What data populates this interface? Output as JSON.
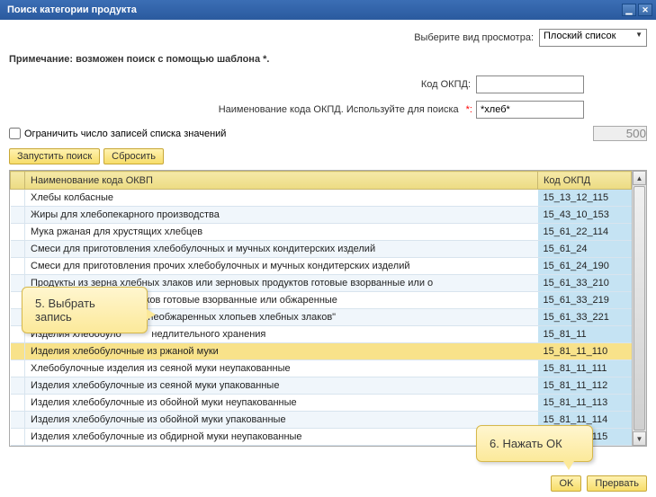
{
  "title": "Поиск категории продукта",
  "view": {
    "label": "Выберите вид просмотра:",
    "value": "Плоский список"
  },
  "note": "Примечание: возможен поиск с помощью шаблона *.",
  "code": {
    "label": "Код ОКПД:",
    "value": ""
  },
  "name_search": {
    "label": "Наименование кода ОКПД. Используйте для поиска",
    "req": "*:",
    "value": "*хлеб*"
  },
  "limit": {
    "label": "Ограничить число записей списка значений",
    "value": "500"
  },
  "buttons": {
    "search": "Запустить поиск",
    "reset": "Сбросить",
    "ok": "OK",
    "cancel": "Прервать"
  },
  "columns": {
    "name": "Наименование кода ОКВП",
    "code": "Код ОКПД"
  },
  "rows": [
    {
      "name": "Хлебы колбасные",
      "code": "15_13_12_115"
    },
    {
      "name": "Жиры для хлебопекарного производства",
      "code": "15_43_10_153"
    },
    {
      "name": "Мука ржаная для хрустящих хлебцев",
      "code": "15_61_22_114"
    },
    {
      "name": "Смеси для приготовления хлебобулочных и мучных кондитерских изделий",
      "code": "15_61_24"
    },
    {
      "name": "Смеси для приготовления прочих хлебобулочных и мучных кондитерских изделий",
      "code": "15_61_24_190"
    },
    {
      "name": "Продукты из зерна хлебных злаков или зерновых продуктов готовые взорванные или о",
      "code": "15_61_33_210"
    },
    {
      "name": "                                    злаков готовые взорванные или обжаренные",
      "code": "15_61_33_219"
    },
    {
      "name": "                              основе необжаренных хлопьев хлебных злаков\"",
      "code": "15_61_33_221"
    },
    {
      "name": "Изделия хлебобуло           недлительного хранения",
      "code": "15_81_11"
    },
    {
      "name": "Изделия хлебобулочные из ржаной муки",
      "code": "15_81_11_110",
      "selected": true
    },
    {
      "name": "Хлебобулочные изделия из сеяной муки неупакованные",
      "code": "15_81_11_111"
    },
    {
      "name": "Изделия хлебобулочные из сеяной муки упакованные",
      "code": "15_81_11_112"
    },
    {
      "name": "Изделия хлебобулочные из обойной муки неупакованные",
      "code": "15_81_11_113"
    },
    {
      "name": "Изделия хлебобулочные из обойной муки упакованные",
      "code": "15_81_11_114"
    },
    {
      "name": "Изделия хлебобулочные из обдирной муки неупакованные",
      "code": "15_81_11_115"
    }
  ],
  "callouts": {
    "c5a": "5. Выбрать",
    "c5b": "запись",
    "c6": "6. Нажать ОК"
  }
}
